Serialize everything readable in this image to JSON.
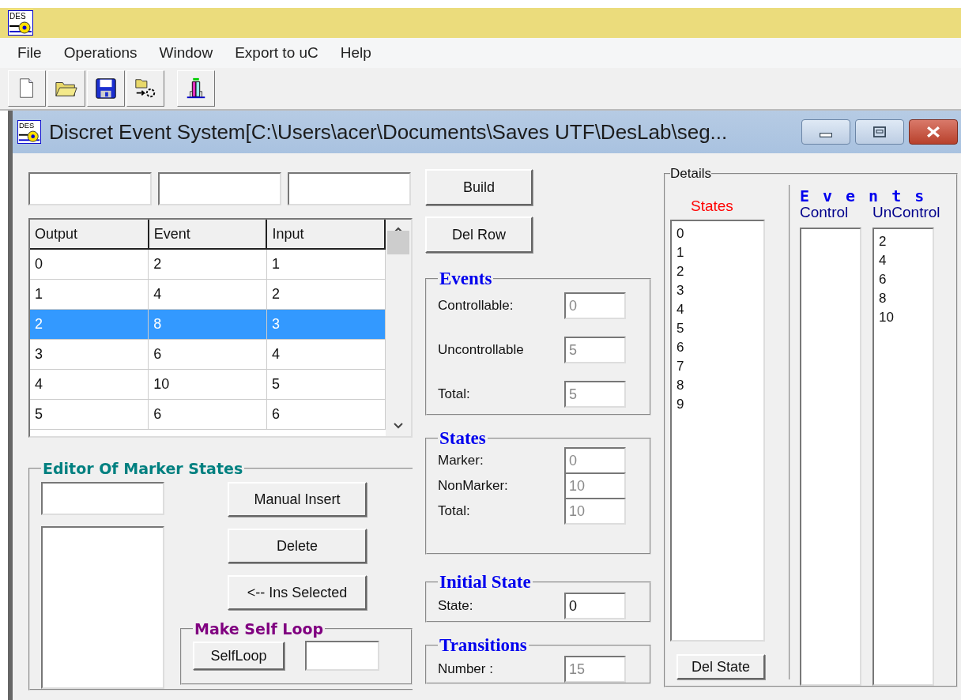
{
  "app": {
    "logo_text": "DES",
    "menu": [
      "File",
      "Operations",
      "Window",
      "Export to uC",
      "Help"
    ]
  },
  "window": {
    "logo_text": "DES",
    "title": "Discret Event System[C:\\Users\\acer\\Documents\\Saves UTF\\DesLab\\seg..."
  },
  "table": {
    "columns": [
      "Output",
      "Event",
      "Input"
    ],
    "rows": [
      {
        "cells": [
          "0",
          "2",
          "1"
        ],
        "selected": false
      },
      {
        "cells": [
          "1",
          "4",
          "2"
        ],
        "selected": false
      },
      {
        "cells": [
          "2",
          "8",
          "3"
        ],
        "selected": true
      },
      {
        "cells": [
          "3",
          "6",
          "4"
        ],
        "selected": false
      },
      {
        "cells": [
          "4",
          "10",
          "5"
        ],
        "selected": false
      },
      {
        "cells": [
          "5",
          "6",
          "6"
        ],
        "selected": false
      }
    ]
  },
  "buttons": [
    "Build",
    "Del Row"
  ],
  "summary_groups": [
    {
      "title": "Events",
      "fields": [
        {
          "label": "Controllable:",
          "value": "0",
          "disabled": true
        },
        {
          "label": "Uncontrollable",
          "value": "5",
          "disabled": true
        },
        {
          "label": "Total:",
          "value": "5",
          "disabled": true
        }
      ]
    },
    {
      "title": "States",
      "fields": [
        {
          "label": "Marker:",
          "value": "0",
          "disabled": true
        },
        {
          "label": "NonMarker:",
          "value": "10",
          "disabled": true
        },
        {
          "label": "Total:",
          "value": "10",
          "disabled": true
        }
      ]
    },
    {
      "title": "Initial State",
      "fields": [
        {
          "label": "State:",
          "value": "0",
          "disabled": false
        }
      ]
    },
    {
      "title": "Transitions",
      "fields": [
        {
          "label": "Number :",
          "value": "15",
          "disabled": true
        }
      ]
    }
  ],
  "marker_editor": {
    "title": "Editor Of Marker States",
    "buttons": [
      "Manual Insert",
      "Delete",
      "<-- Ins Selected"
    ],
    "self_loop": {
      "title": "Make Self Loop",
      "button": "SelfLoop"
    }
  },
  "details": {
    "title": "Details",
    "states": {
      "heading": "States",
      "items": [
        "0",
        "1",
        "2",
        "3",
        "4",
        "5",
        "6",
        "7",
        "8",
        "9"
      ],
      "button": "Del State"
    },
    "events": {
      "heading": "Events",
      "control": {
        "heading": "Control"
      },
      "uncontrol": {
        "heading": "UnControl",
        "items": [
          "2",
          "4",
          "6",
          "8",
          "10"
        ]
      }
    }
  }
}
